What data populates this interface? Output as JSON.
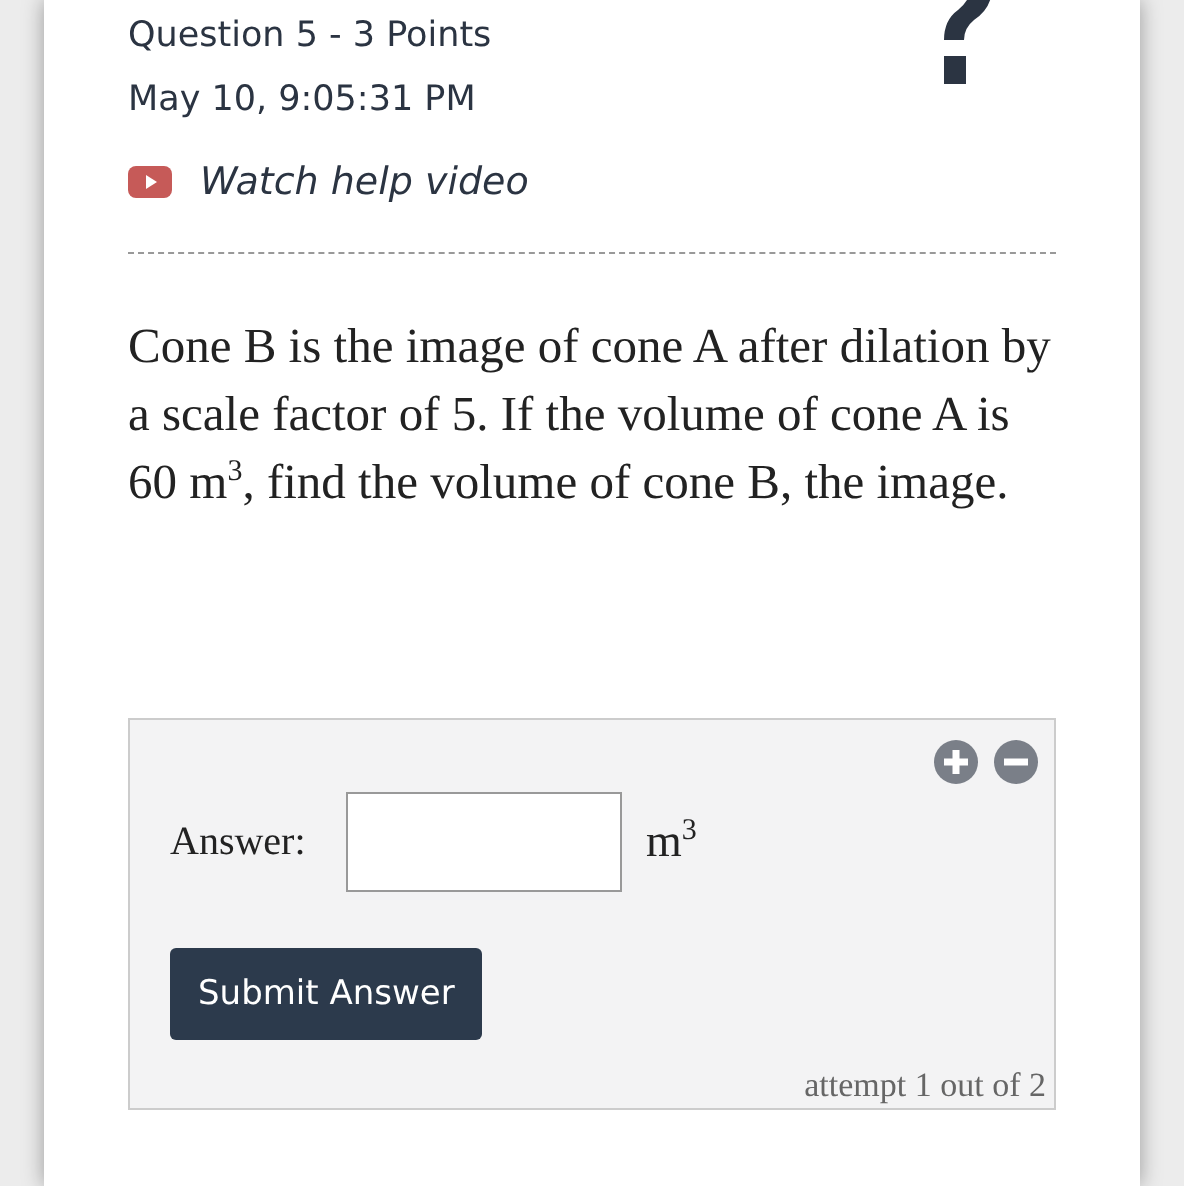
{
  "header": {
    "title": "Question 5 - 3 Points",
    "timestamp": "May 10, 9:05:31 PM",
    "help_link": "Watch help video"
  },
  "question": {
    "text": "Cone B is the image of cone A after dilation by a scale factor of 5. If the volume of cone A is 60 m$^{3}$, find the volume of cone B, the image."
  },
  "answer_panel": {
    "label": "Answer:",
    "unit": "m$^{3}$",
    "submit": "Submit Answer",
    "attempt": "attempt 1 out of 2"
  }
}
